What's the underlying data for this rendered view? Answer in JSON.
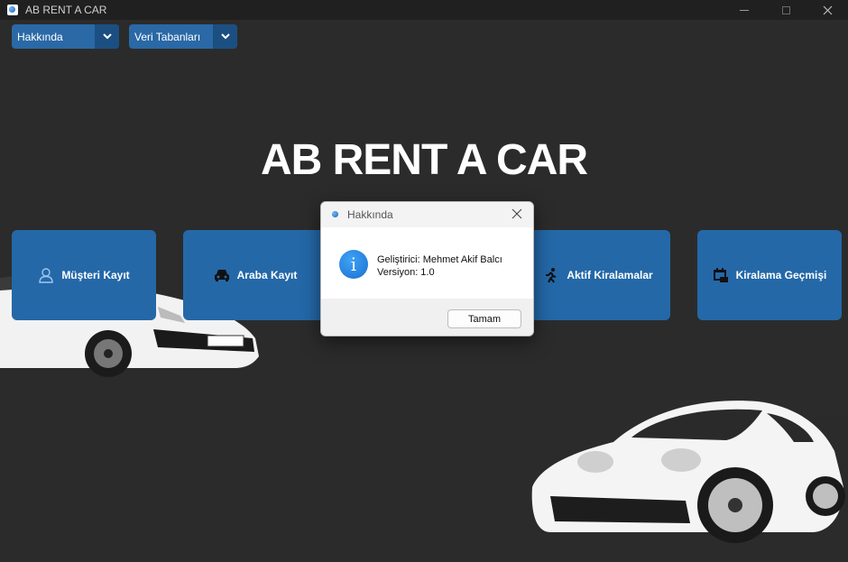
{
  "window": {
    "title": "AB RENT A CAR",
    "minimize_icon": "minimize-icon",
    "maximize_icon": "maximize-icon",
    "close_icon": "close-icon"
  },
  "menu": {
    "about_combo": {
      "value": "Hakkında"
    },
    "database_combo": {
      "value": "Veri Tabanları"
    }
  },
  "main": {
    "title": "AB RENT A CAR"
  },
  "tiles": [
    {
      "label": "Müşteri Kayıt",
      "icon": "user-icon"
    },
    {
      "label": "Araba Kayıt",
      "icon": "car-icon"
    },
    {
      "label": "Aktif Kiralamalar",
      "icon": "running-person-icon"
    },
    {
      "label": "Kiralama Geçmişi",
      "icon": "calendar-icon"
    }
  ],
  "dialog": {
    "title": "Hakkında",
    "line1": "Geliştirici: Mehmet Akif Balcı",
    "line2": "Versiyon: 1.0",
    "ok_label": "Tamam",
    "icon": "info-icon"
  },
  "colors": {
    "background": "#2b2b2b",
    "tile": "#2468a8",
    "combo": "#2a69a6",
    "combo_arrow": "#1c4f81"
  }
}
